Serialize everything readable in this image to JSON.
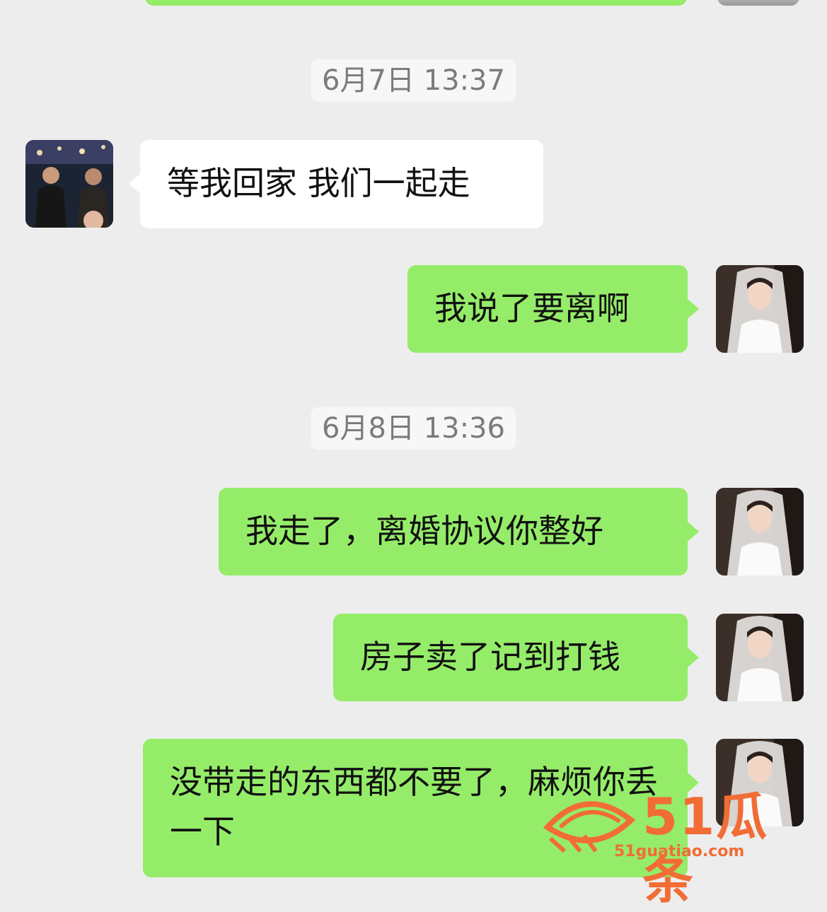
{
  "conversation": {
    "timestamps": [
      "6月7日 13:37",
      "6月8日 13:36"
    ],
    "messages": [
      {
        "sender": "contact",
        "text": "等我回家 我们一起走"
      },
      {
        "sender": "me",
        "text": "我说了要离啊"
      },
      {
        "sender": "me",
        "text": "我走了，离婚协议你整好"
      },
      {
        "sender": "me",
        "text": "房子卖了记到打钱"
      },
      {
        "sender": "me",
        "text": "没带走的东西都不要了，麻烦你丢一下"
      }
    ]
  },
  "watermark": {
    "brand": "51瓜条",
    "url": "51guatiao.com"
  },
  "colors": {
    "background": "#ededed",
    "sent_bubble": "#95ec69",
    "received_bubble": "#ffffff",
    "watermark": "#f26c35"
  }
}
